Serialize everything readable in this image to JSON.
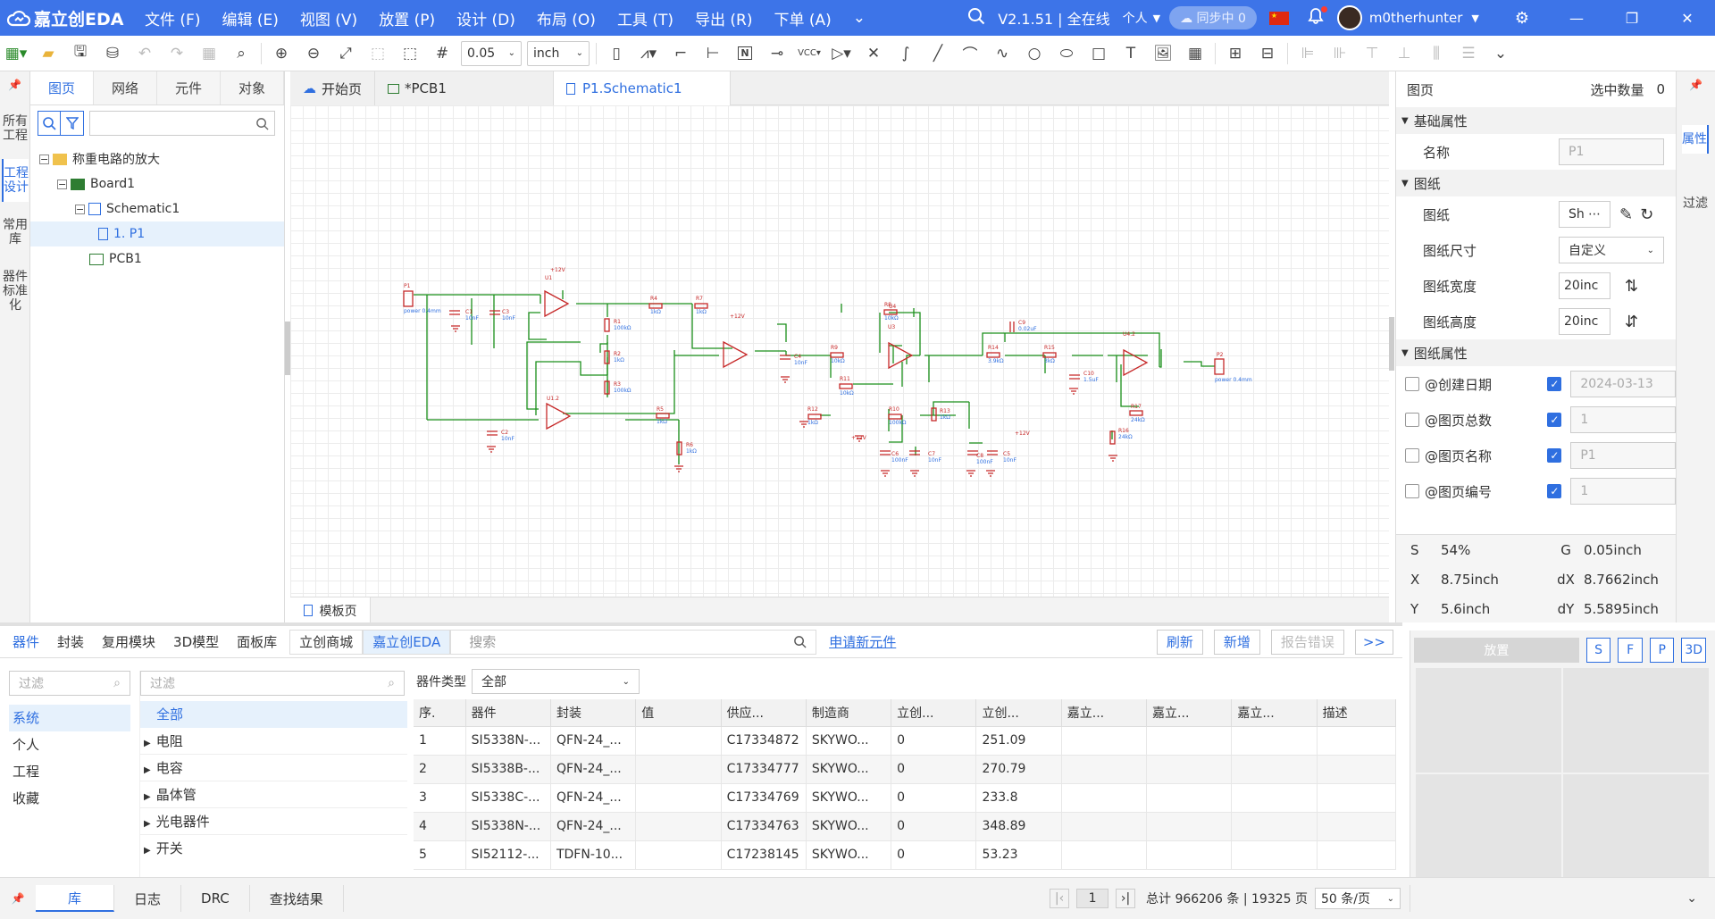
{
  "app": {
    "logo": "嘉立创EDA",
    "menus": [
      "文件 (F)",
      "编辑 (E)",
      "视图 (V)",
      "放置 (P)",
      "设计 (D)",
      "布局 (O)",
      "工具 (T)",
      "导出 (R)",
      "下单 (A)"
    ],
    "version": "V2.1.51 | 全在线",
    "mode": "个人",
    "sync": "同步中 0",
    "user": "m0therhunter"
  },
  "toolbar": {
    "grid": "0.05",
    "unit": "inch",
    "vcc": "VCC",
    "netlabel": "N"
  },
  "left_vtabs": [
    "所有工程",
    "工程设计",
    "常用库",
    "器件标准化"
  ],
  "left_panel": {
    "tabs": [
      "图页",
      "网络",
      "元件",
      "对象"
    ],
    "tree": {
      "project": "称重电路的放大",
      "board": "Board1",
      "schematic": "Schematic1",
      "page": "1. P1",
      "pcb": "PCB1"
    }
  },
  "doc_tabs": [
    "开始页",
    "*PCB1",
    "P1.Schematic1"
  ],
  "page_tab": "模板页",
  "schematic": {
    "labels": {
      "p1": "P1",
      "p1_sub": "power 0.4mm",
      "p2": "P2",
      "p2_sub": "power 0.4mm",
      "u1": "U1",
      "u12": "U1.2",
      "u3": "U3",
      "u4": "U4",
      "u42": "U4.2",
      "vcc1": "+12V",
      "vcc2": "+12V",
      "vcc3": "+12V",
      "vcc4": "+12V",
      "r1": "R1",
      "r1v": "100kΩ",
      "r2": "R2",
      "r2v": "1kΩ",
      "r3": "R3",
      "r3v": "100kΩ",
      "r4": "R4",
      "r4v": "1kΩ",
      "r5": "R5",
      "r5v": "1kΩ",
      "r6": "R6",
      "r6v": "1kΩ",
      "r7": "R7",
      "r7v": "1kΩ",
      "r8": "R8",
      "r8v": "10kΩ",
      "r9": "R9",
      "r9v": "10kΩ",
      "r10": "R10",
      "r10v": "100kΩ",
      "r11": "R11",
      "r11v": "10kΩ",
      "r12": "R12",
      "r12v": "1kΩ",
      "r13": "R13",
      "r13v": "1kΩ",
      "r14": "R14",
      "r14v": "3.9kΩ",
      "r15": "R15",
      "r15v": "3kΩ",
      "r16": "R16",
      "r16v": "24kΩ",
      "r17": "R17",
      "r17v": "24kΩ",
      "c1": "C1",
      "c1v": "10nF",
      "c2": "C2",
      "c2v": "10nF",
      "c3": "C3",
      "c3v": "10nF",
      "c4": "C4",
      "c4v": "10nF",
      "c5": "C5",
      "c5v": "10nF",
      "c6": "C6",
      "c6v": "100nF",
      "c7": "C7",
      "c7v": "10nF",
      "c8": "C8",
      "c8v": "100nF",
      "c9": "C9",
      "c9v": "0.02uF",
      "c10": "C10",
      "c10v": "1.5uF"
    }
  },
  "right_panel": {
    "header": "图页",
    "selected_label": "选中数量",
    "selected_count": "0",
    "basic_section": "基础属性",
    "name_label": "名称",
    "name_value": "P1",
    "drawing_section": "图纸",
    "sheet_label": "图纸",
    "sheet_value": "Sh",
    "size_label": "图纸尺寸",
    "size_value": "自定义",
    "width_label": "图纸宽度",
    "width_value": "20inc",
    "height_label": "图纸高度",
    "height_value": "20inc",
    "props_section": "图纸属性",
    "attrs": [
      {
        "name": "@创建日期",
        "value": "2024-03-13"
      },
      {
        "name": "@图页总数",
        "value": "1"
      },
      {
        "name": "@图页名称",
        "value": "P1"
      },
      {
        "name": "@图页编号",
        "value": "1"
      }
    ],
    "coords": {
      "s_label": "S",
      "s": "54%",
      "g_label": "G",
      "g": "0.05inch",
      "x_label": "X",
      "x": "8.75inch",
      "dx_label": "dX",
      "dx": "8.7662inch",
      "y_label": "Y",
      "y": "5.6inch",
      "dy_label": "dY",
      "dy": "5.5895inch"
    }
  },
  "right_vtabs": [
    "属性",
    "过滤"
  ],
  "library": {
    "tabs": [
      "器件",
      "封装",
      "复用模块",
      "3D模型",
      "面板库"
    ],
    "sources": [
      "立创商城",
      "嘉立创EDA"
    ],
    "search_placeholder": "搜索",
    "apply_link": "申请新元件",
    "buttons": [
      "刷新",
      "新增",
      "报告错误",
      ">>"
    ],
    "filter_placeholder": "过滤",
    "categories_left": [
      "系统",
      "个人",
      "工程",
      "收藏"
    ],
    "categories_mid": [
      "全部",
      "电阻",
      "电容",
      "晶体管",
      "光电器件",
      "开关"
    ],
    "device_type_label": "器件类型",
    "device_type_value": "全部",
    "columns": [
      "序.",
      "器件",
      "封装",
      "值",
      "供应...",
      "制造商",
      "立创...",
      "立创...",
      "嘉立...",
      "嘉立...",
      "嘉立...",
      "描述"
    ],
    "rows": [
      [
        "1",
        "SI5338N-...",
        "QFN-24_...",
        "",
        "C17334872",
        "SKYWO...",
        "0",
        "251.09",
        "",
        "",
        "",
        ""
      ],
      [
        "2",
        "SI5338B-...",
        "QFN-24_...",
        "",
        "C17334777",
        "SKYWO...",
        "0",
        "270.79",
        "",
        "",
        "",
        ""
      ],
      [
        "3",
        "SI5338C-...",
        "QFN-24_...",
        "",
        "C17334769",
        "SKYWO...",
        "0",
        "233.8",
        "",
        "",
        "",
        ""
      ],
      [
        "4",
        "SI5338N-...",
        "QFN-24_...",
        "",
        "C17334763",
        "SKYWO...",
        "0",
        "348.89",
        "",
        "",
        "",
        ""
      ],
      [
        "5",
        "SI52112-...",
        "TDFN-10...",
        "",
        "C17238145",
        "SKYWO...",
        "0",
        "53.23",
        "",
        "",
        "",
        ""
      ]
    ],
    "pagination": {
      "page": "1",
      "total": "总计 966206 条 | 19325 页",
      "per_page": "50 条/页"
    }
  },
  "place_panel": {
    "place": "放置",
    "buttons": [
      "S",
      "F",
      "P",
      "3D"
    ]
  },
  "bottom_tabs": [
    "库",
    "日志",
    "DRC",
    "查找结果"
  ],
  "colors": {
    "accent": "#2f6fe0",
    "titlebar": "#3d74e8",
    "wire": "#1a8f1a",
    "part": "#c62828"
  }
}
